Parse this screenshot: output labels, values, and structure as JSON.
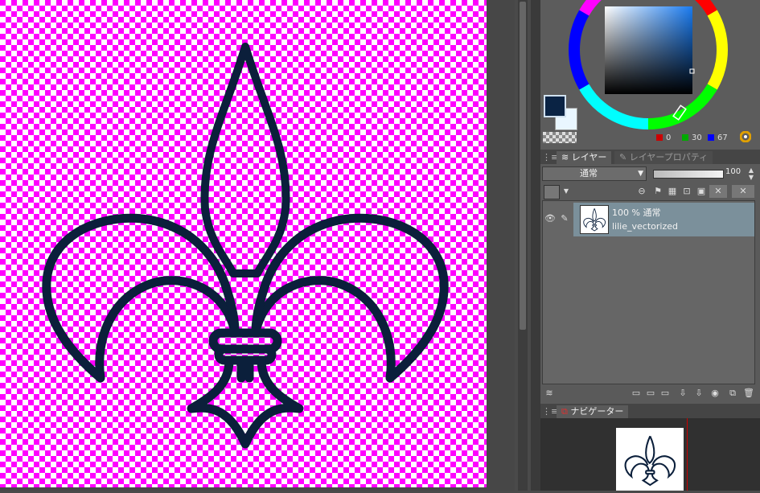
{
  "layer_panel": {
    "tab_layer": "レイヤー",
    "tab_property": "レイヤープロパティ",
    "blend_mode": "通常",
    "opacity": "100"
  },
  "layer": {
    "mode_text": "100 % 通常",
    "name": "lilie_vectorized"
  },
  "color": {
    "rgb_r": "0",
    "rgb_g": "30",
    "rgb_b": "67",
    "main_color": "#0a2344",
    "sub_color": "#e9f6ff"
  },
  "navigator": {
    "tab_label": "ナビゲーター"
  },
  "icons": [
    "eye-icon",
    "pen-icon",
    "new-layer-icon",
    "delete-layer-icon",
    "lock-icon",
    "color-wheel-icon"
  ]
}
